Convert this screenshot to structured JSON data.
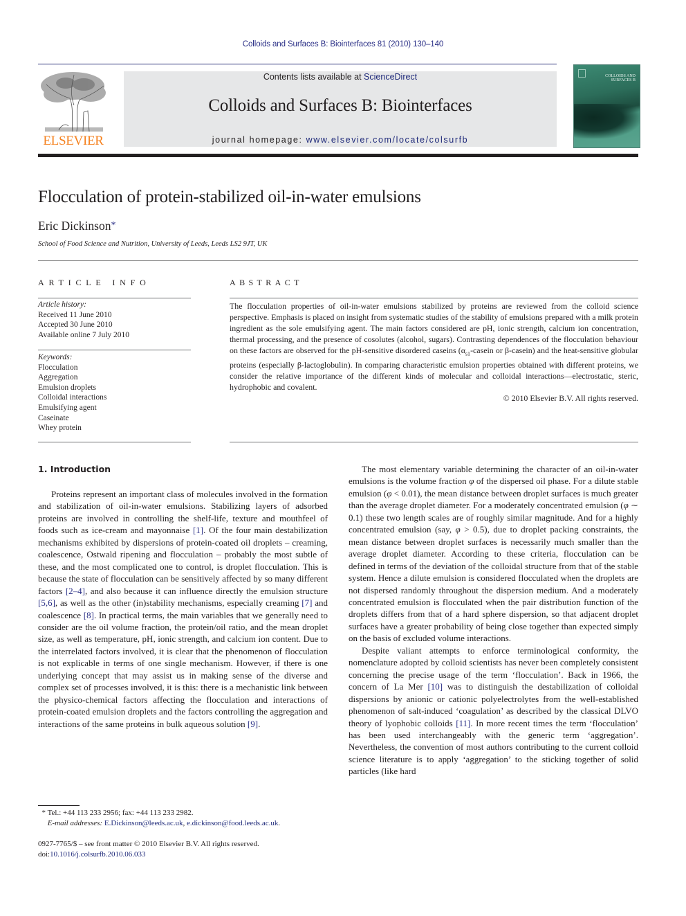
{
  "header": {
    "citation": "Colloids and Surfaces B: Biointerfaces 81 (2010) 130–140",
    "contents_prefix": "Contents lists available at ",
    "contents_link": "ScienceDirect",
    "journal_name": "Colloids and Surfaces B: Biointerfaces",
    "homepage_prefix": "journal homepage: ",
    "homepage_link": "www.elsevier.com/locate/colsurfb",
    "publisher_logo_text": "ELSEVIER",
    "cover_title": "COLLOIDS AND SURFACES B",
    "publisher_color": "#f58220",
    "link_color": "#2a2f86"
  },
  "article": {
    "title": "Flocculation of protein-stabilized oil-in-water emulsions",
    "author": "Eric Dickinson",
    "author_mark": "*",
    "affiliation": "School of Food Science and Nutrition, University of Leeds, Leeds LS2 9JT, UK"
  },
  "article_info": {
    "heading": "ARTICLE INFO",
    "history_label": "Article history:",
    "history": [
      "Received 11 June 2010",
      "Accepted 30 June 2010",
      "Available online 7 July 2010"
    ],
    "keywords_label": "Keywords:",
    "keywords": [
      "Flocculation",
      "Aggregation",
      "Emulsion droplets",
      "Colloidal interactions",
      "Emulsifying agent",
      "Caseinate",
      "Whey protein"
    ]
  },
  "abstract": {
    "heading": "ABSTRACT",
    "part1": "The flocculation properties of oil-in-water emulsions stabilized by proteins are reviewed from the colloid science perspective. Emphasis is placed on insight from systematic studies of the stability of emulsions prepared with a milk protein ingredient as the sole emulsifying agent. The main factors considered are pH, ionic strength, calcium ion concentration, thermal processing, and the presence of cosolutes (alcohol, sugars). Contrasting dependences of the flocculation behaviour on these factors are observed for the pH-sensitive disordered caseins (",
    "alpha": "α",
    "alpha_sub": "s1",
    "part2": "-casein or β-casein) and the heat-sensitive globular proteins (especially β-lactoglobulin). In comparing characteristic emulsion properties obtained with different proteins, we consider the relative importance of the different kinds of molecular and colloidal interactions—electrostatic, steric, hydrophobic and covalent.",
    "copyright": "© 2010 Elsevier B.V. All rights reserved."
  },
  "introduction": {
    "heading": "1.  Introduction",
    "p1": [
      {
        "t": "Proteins represent an important class of molecules involved in the formation and stabilization of oil-in-water emulsions. Stabilizing layers of adsorbed proteins are involved in controlling the shelf-life, texture and mouthfeel of foods such as ice-cream and mayonnaise "
      },
      {
        "r": "[1]"
      },
      {
        "t": ". Of the four main destabilization mechanisms exhibited by dispersions of protein-coated oil droplets – creaming, coalescence, Ostwald ripening and flocculation – probably the most subtle of these, and the most complicated one to control, is droplet flocculation. This is because the state of flocculation can be sensitively affected by so many different factors "
      },
      {
        "r": "[2–4]"
      },
      {
        "t": ", and also because it can influence directly the emulsion structure "
      },
      {
        "r": "[5,6]"
      },
      {
        "t": ", as well as the other (in)stability mechanisms, especially creaming "
      },
      {
        "r": "[7]"
      },
      {
        "t": " and coalescence "
      },
      {
        "r": "[8]"
      },
      {
        "t": ". In practical terms, the main variables that we generally need to consider are the oil volume fraction, the protein/oil ratio, and the mean droplet size, as well as temperature, pH, ionic strength, and calcium ion content. Due to the interrelated factors involved, it is clear that the phenomenon of flocculation is not explicable in terms of one single mechanism. However, if there is one underlying concept that may assist us in making sense of the diverse and complex set of processes involved, it is this: there is a mechanistic link between the physico-chemical factors affecting the flocculation and interactions of protein-coated emulsion droplets and the factors controlling the aggregation and interactions of the same proteins in bulk aqueous solution "
      },
      {
        "r": "[9]"
      },
      {
        "t": "."
      }
    ],
    "p2": [
      {
        "t": "The most elementary variable determining the character of an oil-in-water emulsions is the volume fraction "
      },
      {
        "m": "φ"
      },
      {
        "t": " of the dispersed oil phase. For a dilute stable emulsion ("
      },
      {
        "m": "φ"
      },
      {
        "t": " < 0.01), the mean distance between droplet surfaces is much greater than the average droplet diameter. For a moderately concentrated emulsion ("
      },
      {
        "m": "φ"
      },
      {
        "t": " ∼ 0.1) these two length scales are of roughly similar magnitude. And for a highly concentrated emulsion (say, "
      },
      {
        "m": "φ"
      },
      {
        "t": " > 0.5), due to droplet packing constraints, the mean distance between droplet surfaces is necessarily much smaller than the average droplet diameter. According to these criteria, flocculation can be defined in terms of the deviation of the colloidal structure from that of the stable system. Hence a dilute emulsion is considered flocculated when the droplets are not dispersed randomly throughout the dispersion medium. And a moderately concentrated emulsion is flocculated when the pair distribution function of the droplets differs from that of a hard sphere dispersion, so that adjacent droplet surfaces have a greater probability of being close together than expected simply on the basis of excluded volume interactions."
      }
    ],
    "p3": [
      {
        "t": "Despite valiant attempts to enforce terminological conformity, the nomenclature adopted by colloid scientists has never been completely consistent concerning the precise usage of the term ‘flocculation’. Back in 1966, the concern of La Mer "
      },
      {
        "r": "[10]"
      },
      {
        "t": " was to distinguish the destabilization of colloidal dispersions by anionic or cationic polyelectrolytes from the well-established phenomenon of salt-induced ‘coagulation’ as described by the classical DLVO theory of lyophobic colloids "
      },
      {
        "r": "[11]"
      },
      {
        "t": ". In more recent times the term ‘flocculation’ has been used interchangeably with the generic term ‘aggregation’. Nevertheless, the convention of most authors contributing to the current colloid science literature is to apply ‘aggregation’ to the sticking together of solid particles (like hard"
      }
    ]
  },
  "footnote": {
    "mark": "*",
    "contact": "Tel.: +44 113 233 2956; fax: +44 113 233 2982.",
    "email_label": "E-mail addresses:",
    "email1": "E.Dickinson@leeds.ac.uk",
    "email2": "e.dickinson@food.leeds.ac.uk",
    "issn_line": "0927-7765/$ – see front matter © 2010 Elsevier B.V. All rights reserved.",
    "doi_prefix": "doi:",
    "doi": "10.1016/j.colsurfb.2010.06.033"
  }
}
